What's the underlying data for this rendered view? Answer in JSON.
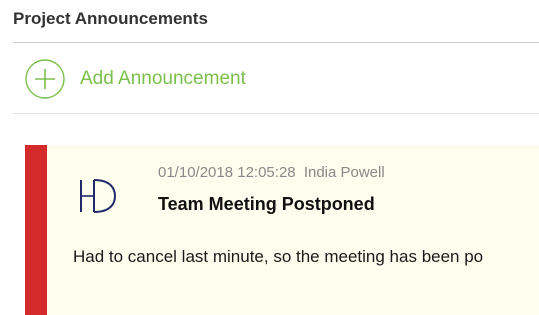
{
  "section": {
    "title": "Project Announcements"
  },
  "add_announcement": {
    "label": "Add Announcement",
    "icon": "plus-circle-icon",
    "color": "#7bbf4c"
  },
  "announcements": [
    {
      "timestamp": "01/10/2018 12:05:28",
      "author": "India Powell",
      "avatar_initials": "HD",
      "title": "Team Meeting Postponed",
      "body": "Had to cancel last minute, so the meeting has been po",
      "accent_color": "#d42a2a",
      "background_color": "#fefeef"
    }
  ]
}
